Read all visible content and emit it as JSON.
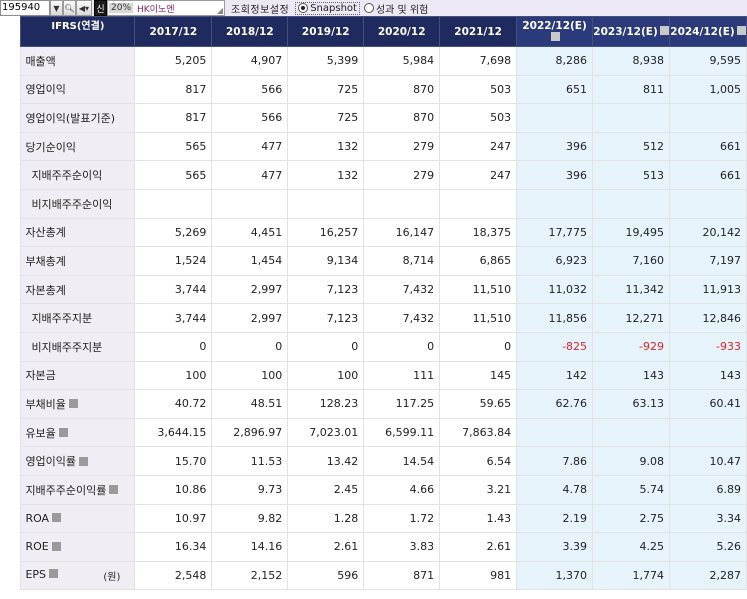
{
  "toolbar": {
    "code": "195940",
    "badge_new": "신",
    "stock_pct": "20%",
    "stock_name": "HK이노엔",
    "label": "조회정보설정",
    "radio_snapshot": "Snapshot",
    "radio_perf": "성과 및 위험"
  },
  "header": {
    "ifrs": "IFRS(연결)",
    "periods": [
      "2017/12",
      "2018/12",
      "2019/12",
      "2020/12",
      "2021/12",
      "2022/12(E)",
      "2023/12(E)",
      "2024/12(E)"
    ]
  },
  "rows": [
    {
      "label": "매출액",
      "values": [
        "5,205",
        "4,907",
        "5,399",
        "5,984",
        "7,698",
        "8,286",
        "8,938",
        "9,595"
      ]
    },
    {
      "label": "영업이익",
      "values": [
        "817",
        "566",
        "725",
        "870",
        "503",
        "651",
        "811",
        "1,005"
      ]
    },
    {
      "label": "영업이익(발표기준)",
      "values": [
        "817",
        "566",
        "725",
        "870",
        "503",
        "",
        "",
        ""
      ]
    },
    {
      "label": "당기순이익",
      "values": [
        "565",
        "477",
        "132",
        "279",
        "247",
        "396",
        "512",
        "661"
      ]
    },
    {
      "label": "지배주주순이익",
      "values": [
        "565",
        "477",
        "132",
        "279",
        "247",
        "396",
        "513",
        "661"
      ]
    },
    {
      "label": "비지배주주순이익",
      "values": [
        "",
        "",
        "",
        "",
        "",
        "",
        "",
        ""
      ]
    },
    {
      "label": "자산총계",
      "values": [
        "5,269",
        "4,451",
        "16,257",
        "16,147",
        "18,375",
        "17,775",
        "19,495",
        "20,142"
      ]
    },
    {
      "label": "부채총계",
      "values": [
        "1,524",
        "1,454",
        "9,134",
        "8,714",
        "6,865",
        "6,923",
        "7,160",
        "7,197"
      ]
    },
    {
      "label": "자본총계",
      "values": [
        "3,744",
        "2,997",
        "7,123",
        "7,432",
        "11,510",
        "11,032",
        "11,342",
        "11,913"
      ]
    },
    {
      "label": "지배주주지분",
      "values": [
        "3,744",
        "2,997",
        "7,123",
        "7,432",
        "11,510",
        "11,856",
        "12,271",
        "12,846"
      ]
    },
    {
      "label": "비지배주주지분",
      "values": [
        "0",
        "0",
        "0",
        "0",
        "0",
        "-825",
        "-929",
        "-933"
      ]
    },
    {
      "label": "자본금",
      "values": [
        "100",
        "100",
        "100",
        "111",
        "145",
        "142",
        "143",
        "143"
      ]
    },
    {
      "label": "부채비율",
      "values": [
        "40.72",
        "48.51",
        "128.23",
        "117.25",
        "59.65",
        "62.76",
        "63.13",
        "60.41"
      ]
    },
    {
      "label": "유보율",
      "values": [
        "3,644.15",
        "2,896.97",
        "7,023.01",
        "6,599.11",
        "7,863.84",
        "",
        "",
        ""
      ]
    },
    {
      "label": "영업이익률",
      "values": [
        "15.70",
        "11.53",
        "13.42",
        "14.54",
        "6.54",
        "7.86",
        "9.08",
        "10.47"
      ]
    },
    {
      "label": "지배주주순이익률",
      "values": [
        "10.86",
        "9.73",
        "2.45",
        "4.66",
        "3.21",
        "4.78",
        "5.74",
        "6.89"
      ]
    },
    {
      "label": "ROA",
      "values": [
        "10.97",
        "9.82",
        "1.28",
        "1.72",
        "1.43",
        "2.19",
        "2.75",
        "3.34"
      ]
    },
    {
      "label": "ROE",
      "values": [
        "16.34",
        "14.16",
        "2.61",
        "3.83",
        "2.61",
        "3.39",
        "4.25",
        "5.26"
      ]
    },
    {
      "label": "EPS",
      "unit": "(원)",
      "values": [
        "2,548",
        "2,152",
        "596",
        "871",
        "981",
        "1,370",
        "1,774",
        "2,287"
      ]
    }
  ]
}
